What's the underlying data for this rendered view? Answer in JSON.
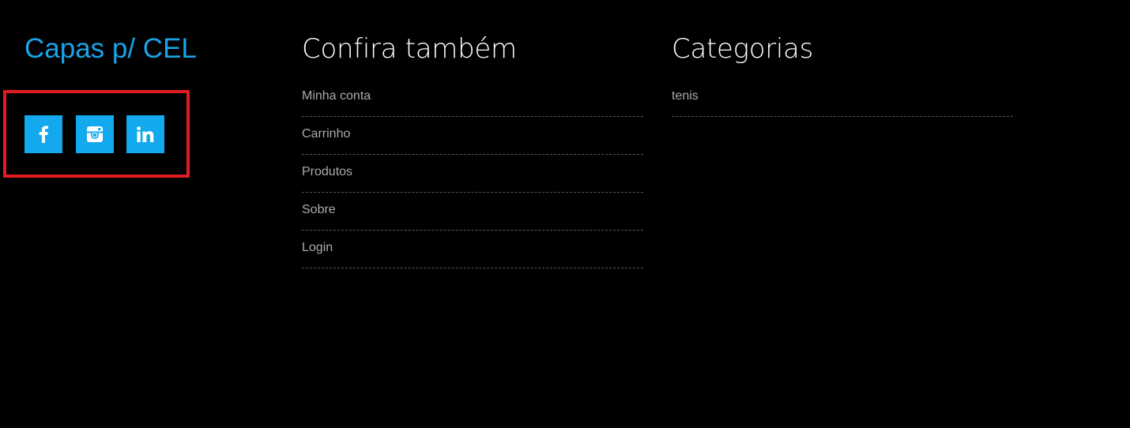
{
  "brand": {
    "title": "Capas p/ CEL",
    "title_color": "#1aa3e8"
  },
  "social": {
    "button_color": "#12a9ee",
    "highlight_color": "#e21b23",
    "items": [
      {
        "name": "facebook",
        "icon": "facebook-icon"
      },
      {
        "name": "instagram",
        "icon": "instagram-icon"
      },
      {
        "name": "linkedin",
        "icon": "linkedin-icon"
      }
    ]
  },
  "links_column": {
    "title": "Confira também",
    "items": [
      {
        "label": "Minha conta"
      },
      {
        "label": "Carrinho"
      },
      {
        "label": "Produtos"
      },
      {
        "label": "Sobre"
      },
      {
        "label": "Login"
      }
    ]
  },
  "categories_column": {
    "title": "Categorias",
    "items": [
      {
        "label": "tenis"
      }
    ]
  }
}
